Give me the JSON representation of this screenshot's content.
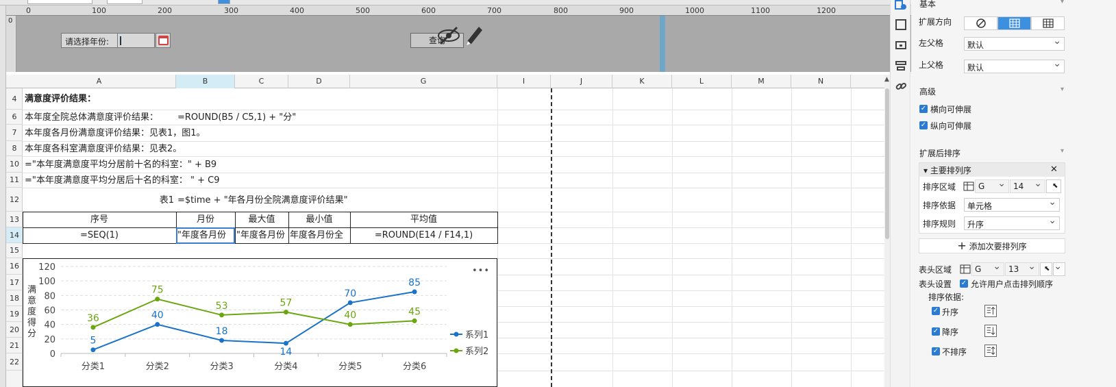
{
  "ruler": {
    "marks": [
      "0",
      "100",
      "200",
      "300",
      "400",
      "500",
      "600",
      "700",
      "800",
      "900",
      "1000",
      "1100",
      "1200"
    ],
    "vmark": "0"
  },
  "param_pane": {
    "year_label": "请选择年份:",
    "query_label": "查询"
  },
  "grid": {
    "columns": [
      "A",
      "B",
      "C",
      "D",
      "G",
      "I",
      "J",
      "K",
      "L",
      "M",
      "N"
    ],
    "rows": [
      "4",
      "6",
      "7",
      "8",
      "10",
      "11",
      "12",
      "13",
      "14",
      "15",
      "16",
      "17",
      "18",
      "19",
      "20",
      "21",
      "22"
    ],
    "cells": {
      "r4": "满意度评价结果：",
      "r6a": "本年度全院总体满意度评价结果：",
      "r6b": "=ROUND(B5 / C5,1) + \"分\"",
      "r7": "本年度各月份满意度评价结果：见表1，图1。",
      "r8": "本年度各科室满意度评价结果：见表2。",
      "r10": "=\"本年度满意度平均分居前十名的科室：\" + B9",
      "r11": "=\"本年度满意度平均分居后十名的科室：  \" + C9",
      "r12a": "表1",
      "r12b": "=$time + \"年各月份全院满意度评价结果\"",
      "h_seq": "序号",
      "h_month": "月份",
      "h_max": "最大值",
      "h_min": "最小值",
      "h_avg": "平均值",
      "r14a": "=SEQ(1)",
      "r14b": "\"年度各月份",
      "r14c": "\"年度各月份",
      "r14d": "年度各月份全",
      "r14g": "=ROUND(E14 / F14,1)"
    }
  },
  "chart_data": {
    "type": "line",
    "categories": [
      "分类1",
      "分类2",
      "分类3",
      "分类4",
      "分类5",
      "分类6"
    ],
    "series": [
      {
        "name": "系列1",
        "values": [
          5,
          40,
          18,
          14,
          70,
          85
        ],
        "color": "#1a73c9"
      },
      {
        "name": "系列2",
        "values": [
          36,
          75,
          53,
          57,
          40,
          45
        ],
        "color": "#6aa60f"
      }
    ],
    "ylabel": "满意度得分",
    "yticks": [
      "0",
      "20",
      "40",
      "60",
      "80",
      "100",
      "120"
    ],
    "ylim": [
      0,
      120
    ],
    "legend": "right",
    "menu": "•••"
  },
  "panel": {
    "sec_basic": "基本",
    "expand_dir": "扩展方向",
    "left_parent": "左父格",
    "left_parent_val": "默认",
    "top_parent": "上父格",
    "top_parent_val": "默认",
    "sec_advanced": "高级",
    "h_stretch": "横向可伸展",
    "v_stretch": "纵向可伸展",
    "sec_sort": "扩展后排序",
    "primary_sort": "主要排列序",
    "sort_area": "排序区域",
    "sort_area_col": "G",
    "sort_area_row": "14",
    "sort_by": "排序依据",
    "sort_by_val": "单元格",
    "sort_rule": "排序规则",
    "sort_rule_val": "升序",
    "add_secondary": "添加次要排列序",
    "header_area": "表头区域",
    "header_col": "G",
    "header_row": "13",
    "header_settings": "表头设置",
    "allow_user_sort": "允许用户点击排列顺序",
    "sort_basis": "排序依据:",
    "opt_asc": "升序",
    "opt_desc": "降序",
    "opt_none": "不排序"
  }
}
